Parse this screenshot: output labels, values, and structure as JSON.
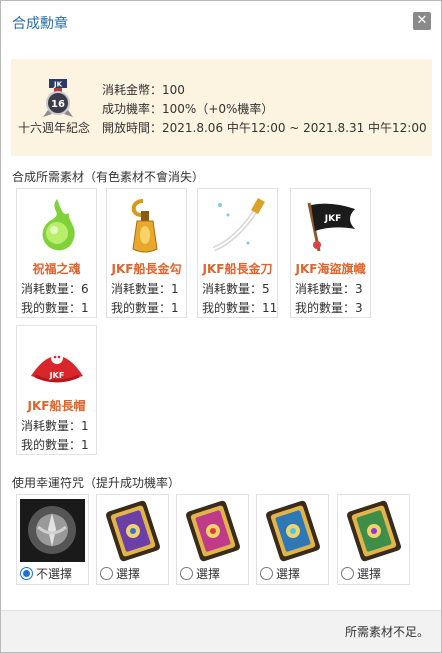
{
  "dialog": {
    "title": "合成勳章",
    "close_label": "✕"
  },
  "medal": {
    "name": "十六週年紀念",
    "icon": "jk-16th-anniversary-medal-icon",
    "cost": "消耗金幣：100",
    "success_rate": "成功機率：100%（+0%機率）",
    "open_time": "開放時間：2021.8.06 中午12:00 ~ 2021.8.31 中午12:00"
  },
  "materials_section": {
    "label": "合成所需素材（有色素材不會消失）",
    "items": [
      {
        "name": "祝福之魂",
        "consume": "消耗數量：6",
        "owned": "我的數量：1",
        "icon": "green-soul-flame-icon"
      },
      {
        "name": "JKF船長金勾",
        "consume": "消耗數量：1",
        "owned": "我的數量：1",
        "icon": "golden-hook-icon"
      },
      {
        "name": "JKF船長金刀",
        "consume": "消耗數量：5",
        "owned": "我的數量：11",
        "icon": "golden-saber-icon"
      },
      {
        "name": "JKF海盜旗幟",
        "consume": "消耗數量：3",
        "owned": "我的數量：3",
        "icon": "pirate-flag-icon"
      },
      {
        "name": "JKF船長帽",
        "consume": "消耗數量：1",
        "owned": "我的數量：1",
        "icon": "pirate-captain-hat-icon"
      }
    ]
  },
  "charm_section": {
    "label": "使用幸運符咒（提升成功機率）",
    "options": [
      {
        "label": "不選擇",
        "selected": true,
        "icon": "no-charm-emblem-icon"
      },
      {
        "label": "選擇",
        "selected": false,
        "icon": "purple-charm-card-icon",
        "color": "#6c3fa8"
      },
      {
        "label": "選擇",
        "selected": false,
        "icon": "magenta-charm-card-icon",
        "color": "#c03a8a"
      },
      {
        "label": "選擇",
        "selected": false,
        "icon": "blue-charm-card-icon",
        "color": "#2f78b7"
      },
      {
        "label": "選擇",
        "selected": false,
        "icon": "green-charm-card-icon",
        "color": "#3e8e4a"
      }
    ]
  },
  "footer": {
    "message": "所需素材不足。"
  }
}
